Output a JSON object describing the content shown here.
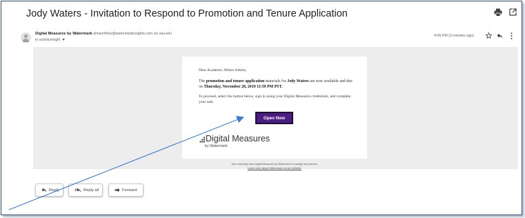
{
  "email": {
    "subject": "Jody Waters - Invitation to Respond to Promotion and Tenure Application",
    "sender_name": "Digital Measures by Watermark",
    "sender_address": "dmworkflow@watermarkinsights.com via sau.edu",
    "recipient": "to activityinsight",
    "timestamp": "4:06 PM (3 minutes ago)"
  },
  "message": {
    "greeting": "Dear Academic Affairs Admin,",
    "para1_pre": "The ",
    "para1_bold1": "promotion and tenure application",
    "para1_mid": " materials for ",
    "para1_bold2": "Jody Waters",
    "para1_mid2": " are now available and due on ",
    "para1_bold3": "Thursday, November 28, 2019 11:59 PM PST.",
    "para2": "To proceed, select the button below, sign in using your Digital Measures credentials, and complete your task.",
    "button_label": "Open Now",
    "logo_name": "Digital Measures",
    "logo_sub": "by Watermark",
    "footer_line1": "Your university uses Digital Measures by Watermark to manage this process.",
    "footer_line2": "Learn more about Watermark on our website."
  },
  "actions": {
    "reply": "Reply",
    "reply_all": "Reply all",
    "forward": "Forward"
  },
  "icons": [
    "person-icon",
    "print-icon",
    "popout-icon",
    "star-icon",
    "reply-icon",
    "more-vert-icon",
    "reply-all-icon",
    "forward-icon",
    "logo-dots-icon"
  ],
  "colors": {
    "button": "#4b1c82",
    "annotation_arrow": "#3b7dd8",
    "frame_border": "#2a4d7a",
    "body_background": "#ededed"
  }
}
